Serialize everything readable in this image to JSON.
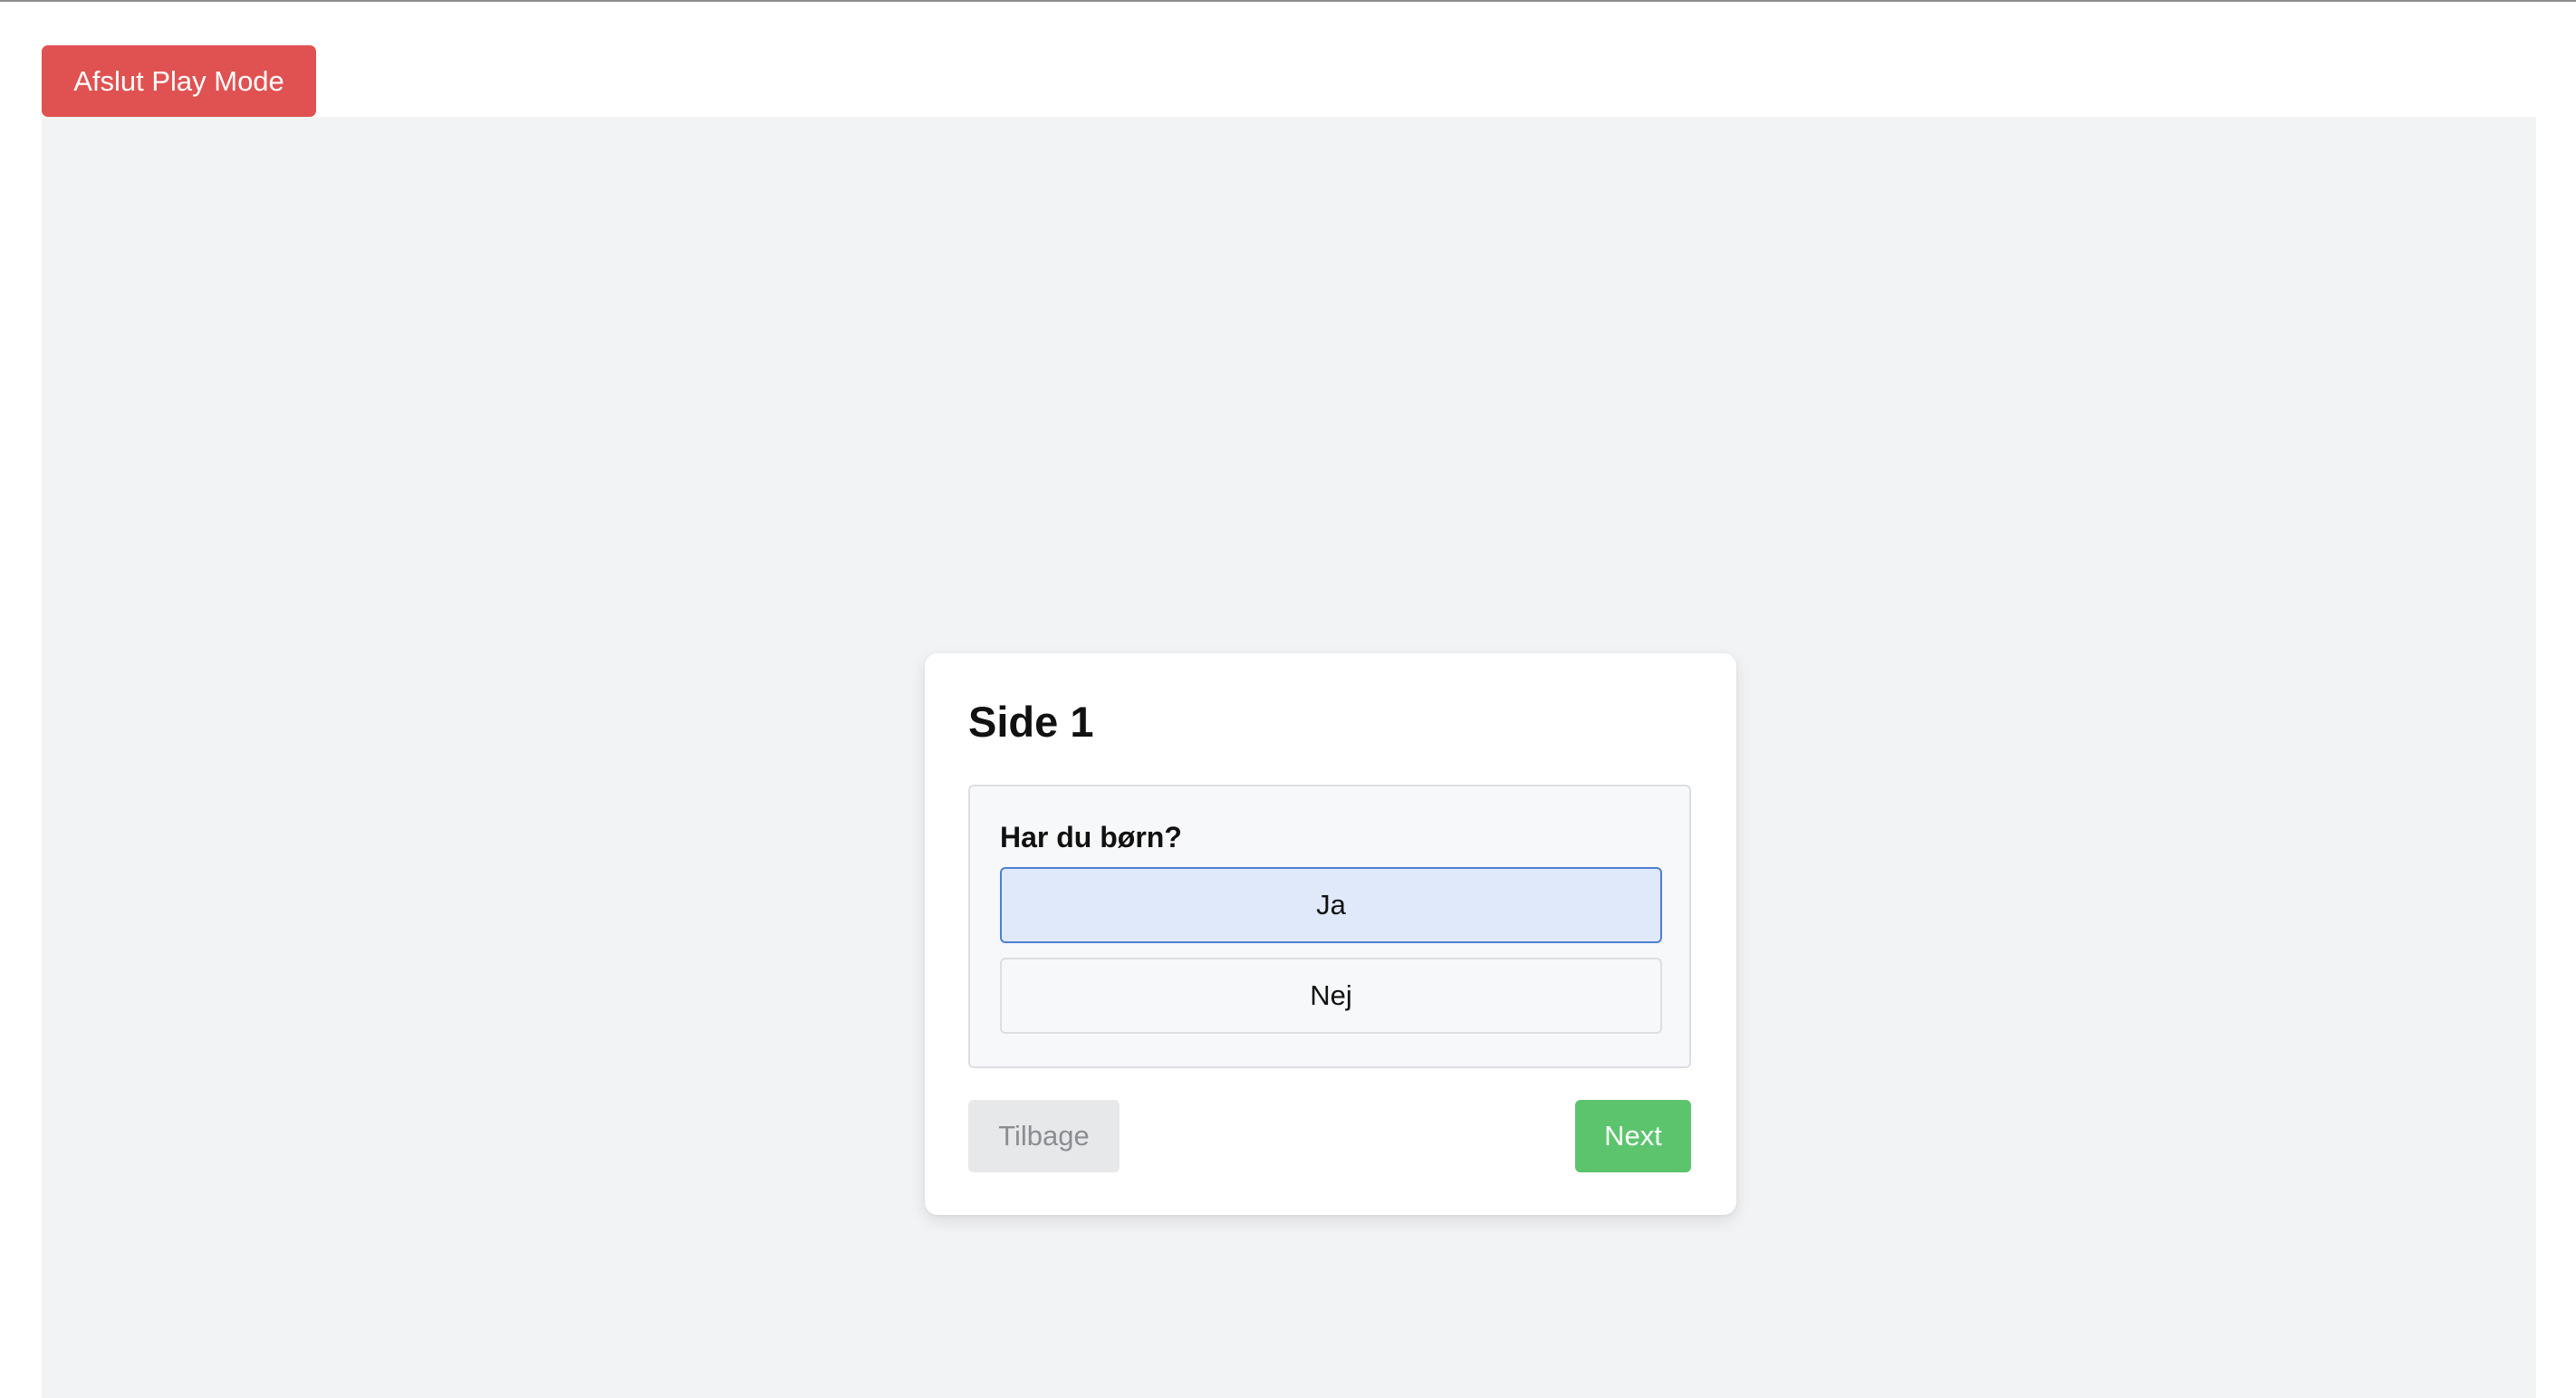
{
  "toolbar": {
    "exit_label": "Afslut Play Mode"
  },
  "card": {
    "title": "Side 1",
    "question": {
      "label": "Har du børn?",
      "options": [
        {
          "label": "Ja",
          "selected": true
        },
        {
          "label": "Nej",
          "selected": false
        }
      ]
    },
    "nav": {
      "back_label": "Tilbage",
      "back_enabled": false,
      "next_label": "Next"
    }
  },
  "colors": {
    "exit_button": "#e05252",
    "stage_background": "#f2f3f5",
    "selected_option_bg": "#dfe9fa",
    "selected_option_border": "#4d7fd1",
    "next_button": "#5cc46d",
    "back_button_disabled": "#e7e8ea"
  }
}
